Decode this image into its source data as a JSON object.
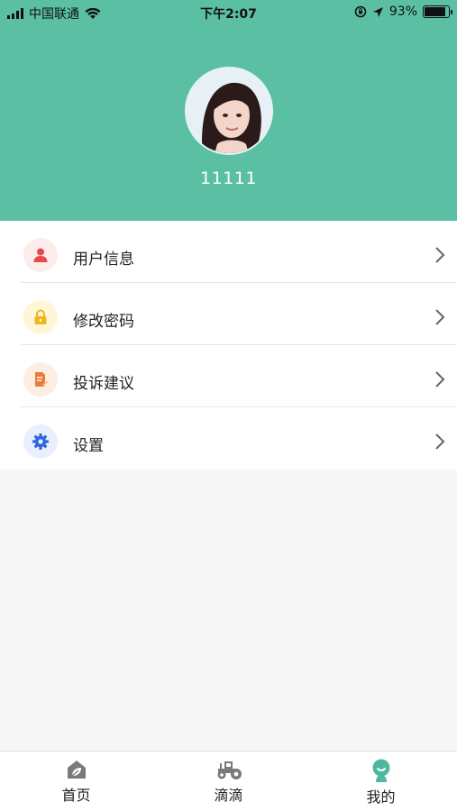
{
  "status_bar": {
    "carrier": "中国联通",
    "time": "下午2:07",
    "battery": "93%",
    "battery_level": 0.93
  },
  "profile": {
    "username": "11111",
    "avatar_icon": "user-avatar-photo"
  },
  "menu": {
    "items": [
      {
        "label": "用户信息",
        "icon": "user-icon",
        "color": "#e8494b",
        "bg": "#fdecec"
      },
      {
        "label": "修改密码",
        "icon": "lock-icon",
        "color": "#f0b61e",
        "bg": "#fff6d8"
      },
      {
        "label": "投诉建议",
        "icon": "document-edit-icon",
        "color": "#ee7a3c",
        "bg": "#fdeee3"
      },
      {
        "label": "设置",
        "icon": "gear-icon",
        "color": "#2f66e0",
        "bg": "#e9f0fd"
      }
    ]
  },
  "tabbar": {
    "tabs": [
      {
        "label": "首页",
        "icon": "home-leaf-icon",
        "active": false
      },
      {
        "label": "滴滴",
        "icon": "tractor-icon",
        "active": false
      },
      {
        "label": "我的",
        "icon": "profile-smile-icon",
        "active": true
      }
    ]
  },
  "colors": {
    "primary": "#5bbfa4",
    "tab_inactive": "#7a7a7a",
    "tab_active": "#4db89f"
  }
}
